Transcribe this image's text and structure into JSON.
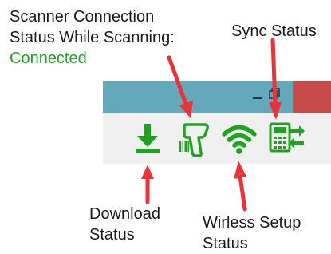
{
  "annotations": {
    "scanner_connection": {
      "line1": "Scanner Connection",
      "line2": "Status While Scanning:",
      "value": "Connected"
    },
    "sync_status": {
      "line1": "Sync Status"
    },
    "download_status": {
      "line1": "Download",
      "line2": "Status"
    },
    "wireless_status": {
      "line1": "Wirless Setup",
      "line2": "Status"
    }
  },
  "toolbar": {
    "icons": [
      "download-icon",
      "barcode-scanner-icon",
      "wifi-icon",
      "sync-icon"
    ]
  },
  "colors": {
    "icon_green": "#1fa31f",
    "arrow_red": "#e8333a",
    "titlebar": "#64a8ba",
    "close_button": "#c84a4a",
    "toolbar_bg": "#f0f0f0"
  }
}
